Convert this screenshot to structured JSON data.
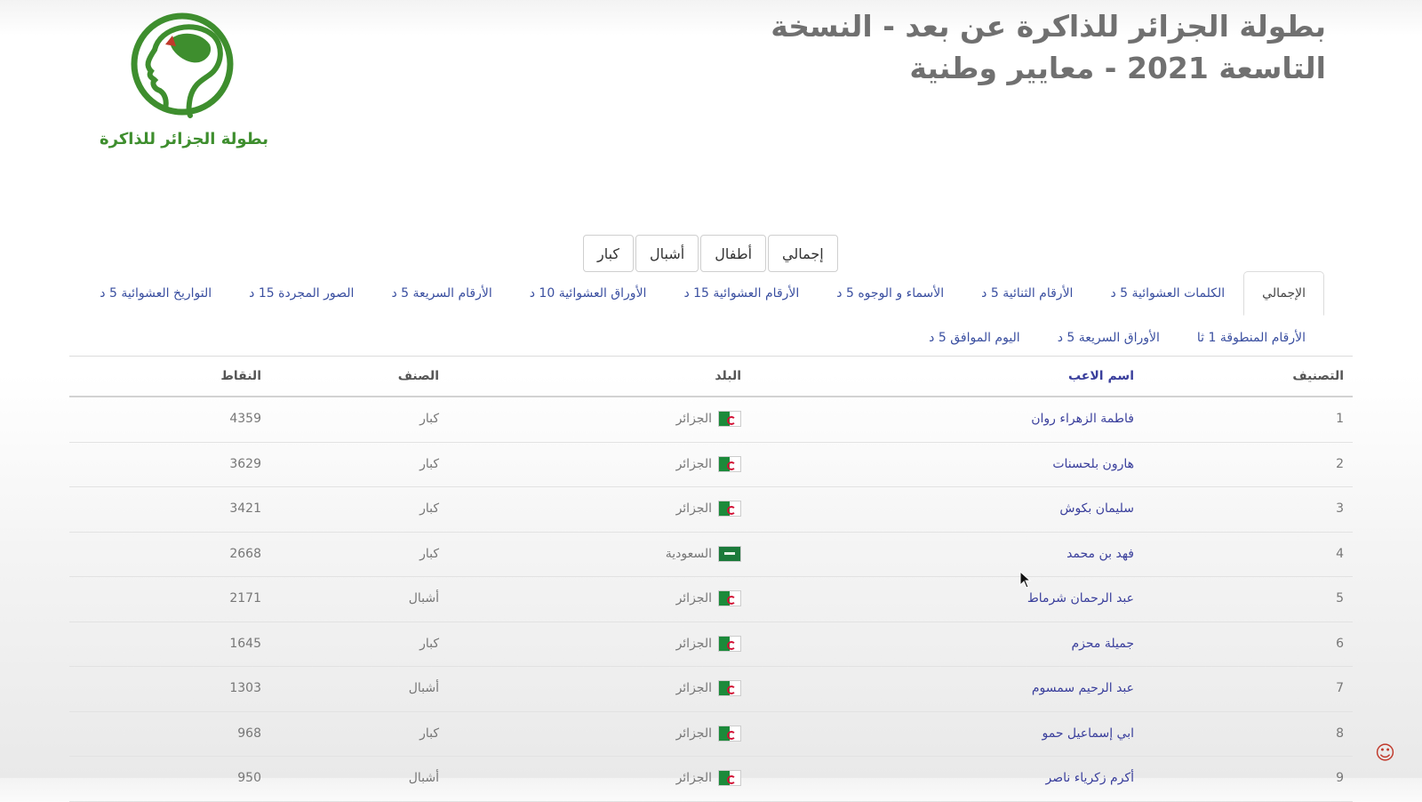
{
  "header": {
    "title": "بطولة الجزائر للذاكرة عن بعد - النسخة التاسعة 2021 - معايير وطنية",
    "logo_text": "بطولة الجزائر للذاكرة"
  },
  "age_tabs": [
    "إجمالي",
    "أطفال",
    "أشبال",
    "كبار"
  ],
  "event_tabs": [
    "الإجمالي",
    "الكلمات العشوائية 5 د",
    "الأرقام الثنائية 5 د",
    "الأسماء و الوجوه 5 د",
    "الأرقام العشوائية 15 د",
    "الأوراق العشوائية 10 د",
    "الأرقام السريعة 5 د",
    "الصور المجردة 15 د",
    "التواريخ العشوائية 5 د",
    "الأرقام المنطوقة 1 ثا",
    "الأوراق السريعة 5 د",
    "اليوم الموافق 5 د"
  ],
  "table": {
    "headers": {
      "rank": "التصنيف",
      "name": "اسم الاعب",
      "country": "البلد",
      "category": "الصنف",
      "points": "النقاط"
    },
    "rows": [
      {
        "rank": "1",
        "name": "فاطمة الزهراء روان",
        "country": "الجزائر",
        "flag": "dz",
        "category": "كبار",
        "points": "4359"
      },
      {
        "rank": "2",
        "name": "هارون بلحسنات",
        "country": "الجزائر",
        "flag": "dz",
        "category": "كبار",
        "points": "3629"
      },
      {
        "rank": "3",
        "name": "سليمان بكوش",
        "country": "الجزائر",
        "flag": "dz",
        "category": "كبار",
        "points": "3421"
      },
      {
        "rank": "4",
        "name": "فهد بن محمد",
        "country": "السعودية",
        "flag": "sa",
        "category": "كبار",
        "points": "2668"
      },
      {
        "rank": "5",
        "name": "عبد الرحمان شرماط",
        "country": "الجزائر",
        "flag": "dz",
        "category": "أشبال",
        "points": "2171"
      },
      {
        "rank": "6",
        "name": "جميلة محزم",
        "country": "الجزائر",
        "flag": "dz",
        "category": "كبار",
        "points": "1645"
      },
      {
        "rank": "7",
        "name": "عبد الرحيم سمسوم",
        "country": "الجزائر",
        "flag": "dz",
        "category": "أشبال",
        "points": "1303"
      },
      {
        "rank": "8",
        "name": "ابي إسماعيل حمو",
        "country": "الجزائر",
        "flag": "dz",
        "category": "كبار",
        "points": "968"
      },
      {
        "rank": "9",
        "name": "أكرم زكرياء ناصر",
        "country": "الجزائر",
        "flag": "dz",
        "category": "أشبال",
        "points": "950"
      }
    ]
  },
  "colors": {
    "brand_green": "#3e8e2e",
    "link_blue": "#3a4fa0"
  }
}
